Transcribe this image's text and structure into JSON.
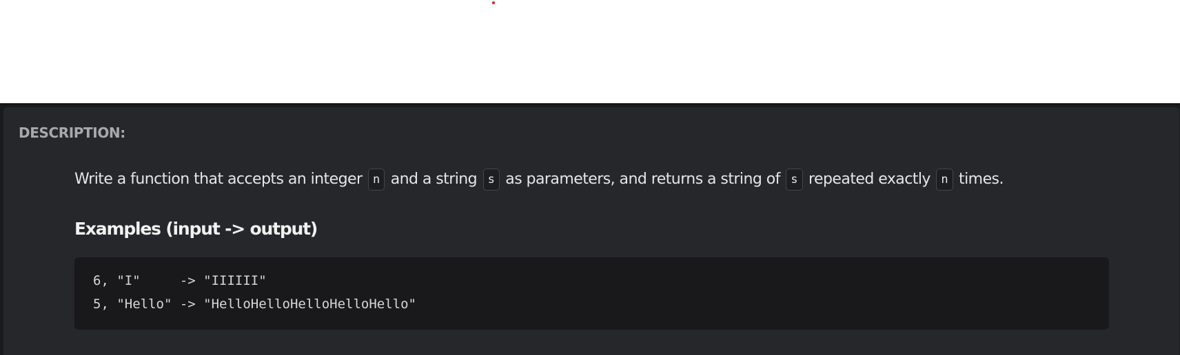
{
  "description": {
    "heading": "DESCRIPTION:",
    "text_parts": {
      "p1": "Write a function that accepts an integer",
      "code1": "n",
      "p2": "and a string",
      "code2": "s",
      "p3": "as parameters, and returns a string of",
      "code3": "s",
      "p4": "repeated exactly",
      "code4": "n",
      "p5": "times."
    }
  },
  "examples": {
    "heading": "Examples (input -> output)",
    "lines": [
      "6, \"I\"     -> \"IIIIII\"",
      "5, \"Hello\" -> \"HelloHelloHelloHelloHello\""
    ]
  },
  "colors": {
    "panel_background": "#26272b",
    "code_background": "#19191b",
    "heading_muted": "#a9a9ad",
    "text": "#e6e6e6",
    "accent_dot": "#d21f1f"
  }
}
